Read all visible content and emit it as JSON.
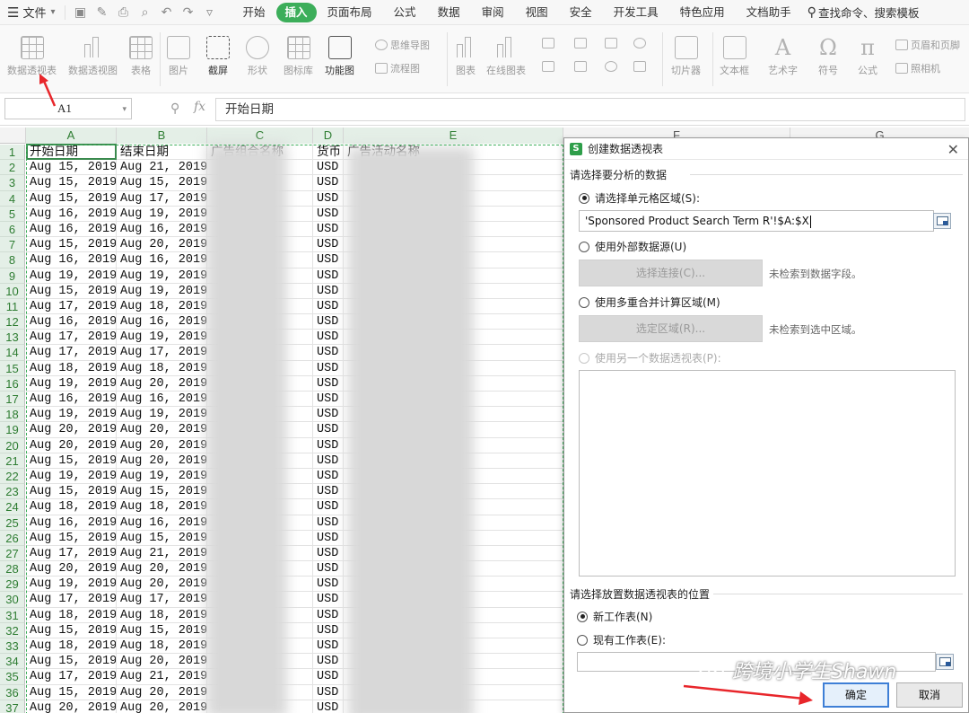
{
  "menubar": {
    "file_label": "文件",
    "tabs": [
      {
        "label": "开始",
        "active": false
      },
      {
        "label": "插入",
        "active": true
      },
      {
        "label": "页面布局",
        "active": false
      },
      {
        "label": "公式",
        "active": false
      },
      {
        "label": "数据",
        "active": false
      },
      {
        "label": "审阅",
        "active": false
      },
      {
        "label": "视图",
        "active": false
      },
      {
        "label": "安全",
        "active": false
      },
      {
        "label": "开发工具",
        "active": false
      },
      {
        "label": "特色应用",
        "active": false
      },
      {
        "label": "文档助手",
        "active": false
      }
    ],
    "search_label": "查找命令、搜索模板"
  },
  "ribbon": {
    "pivot_table": "数据透视表",
    "pivot_chart": "数据透视图",
    "table": "表格",
    "picture": "图片",
    "screenshot": "截屏",
    "shapes": "形状",
    "icon_lib": "图标库",
    "function_chart": "功能图",
    "mind_map": "思维导图",
    "flowchart": "流程图",
    "chart": "图表",
    "online_chart": "在线图表",
    "slicer": "切片器",
    "textbox": "文本框",
    "wordart": "艺术字",
    "symbol": "符号",
    "formula": "公式",
    "header_footer": "页眉和页脚",
    "camera": "照相机"
  },
  "formula_bar": {
    "name_box": "A1",
    "fx": "fx",
    "content": "开始日期"
  },
  "sheet": {
    "columns": [
      "A",
      "B",
      "C",
      "D",
      "E",
      "F",
      "G"
    ],
    "headers": {
      "A": "开始日期",
      "B": "结束日期",
      "C": "广告组合名称",
      "D": "货币",
      "E": "广告活动名称"
    },
    "row_numbers": [
      "1",
      "2",
      "3",
      "4",
      "5",
      "6",
      "7",
      "8",
      "9",
      "10",
      "11",
      "12",
      "13",
      "14",
      "15",
      "16",
      "17",
      "18",
      "19",
      "20",
      "21",
      "22",
      "23",
      "24",
      "25",
      "26",
      "27",
      "28",
      "29",
      "30",
      "31",
      "32",
      "33",
      "34",
      "35",
      "36",
      "37"
    ],
    "rows": [
      [
        "Aug 15, 2019",
        "Aug 21, 2019",
        "USD"
      ],
      [
        "Aug 15, 2019",
        "Aug 15, 2019",
        "USD"
      ],
      [
        "Aug 15, 2019",
        "Aug 17, 2019",
        "USD"
      ],
      [
        "Aug 16, 2019",
        "Aug 19, 2019",
        "USD"
      ],
      [
        "Aug 16, 2019",
        "Aug 16, 2019",
        "USD"
      ],
      [
        "Aug 15, 2019",
        "Aug 20, 2019",
        "USD"
      ],
      [
        "Aug 16, 2019",
        "Aug 16, 2019",
        "USD"
      ],
      [
        "Aug 19, 2019",
        "Aug 19, 2019",
        "USD"
      ],
      [
        "Aug 15, 2019",
        "Aug 19, 2019",
        "USD"
      ],
      [
        "Aug 17, 2019",
        "Aug 18, 2019",
        "USD"
      ],
      [
        "Aug 16, 2019",
        "Aug 16, 2019",
        "USD"
      ],
      [
        "Aug 17, 2019",
        "Aug 19, 2019",
        "USD"
      ],
      [
        "Aug 17, 2019",
        "Aug 17, 2019",
        "USD"
      ],
      [
        "Aug 18, 2019",
        "Aug 18, 2019",
        "USD"
      ],
      [
        "Aug 19, 2019",
        "Aug 20, 2019",
        "USD"
      ],
      [
        "Aug 16, 2019",
        "Aug 16, 2019",
        "USD"
      ],
      [
        "Aug 19, 2019",
        "Aug 19, 2019",
        "USD"
      ],
      [
        "Aug 20, 2019",
        "Aug 20, 2019",
        "USD"
      ],
      [
        "Aug 20, 2019",
        "Aug 20, 2019",
        "USD"
      ],
      [
        "Aug 15, 2019",
        "Aug 20, 2019",
        "USD"
      ],
      [
        "Aug 19, 2019",
        "Aug 19, 2019",
        "USD"
      ],
      [
        "Aug 15, 2019",
        "Aug 15, 2019",
        "USD"
      ],
      [
        "Aug 18, 2019",
        "Aug 18, 2019",
        "USD"
      ],
      [
        "Aug 16, 2019",
        "Aug 16, 2019",
        "USD"
      ],
      [
        "Aug 15, 2019",
        "Aug 15, 2019",
        "USD"
      ],
      [
        "Aug 17, 2019",
        "Aug 21, 2019",
        "USD"
      ],
      [
        "Aug 20, 2019",
        "Aug 20, 2019",
        "USD"
      ],
      [
        "Aug 19, 2019",
        "Aug 20, 2019",
        "USD"
      ],
      [
        "Aug 17, 2019",
        "Aug 17, 2019",
        "USD"
      ],
      [
        "Aug 18, 2019",
        "Aug 18, 2019",
        "USD"
      ],
      [
        "Aug 15, 2019",
        "Aug 15, 2019",
        "USD"
      ],
      [
        "Aug 18, 2019",
        "Aug 18, 2019",
        "USD"
      ],
      [
        "Aug 15, 2019",
        "Aug 20, 2019",
        "USD"
      ],
      [
        "Aug 17, 2019",
        "Aug 21, 2019",
        "USD"
      ],
      [
        "Aug 15, 2019",
        "Aug 20, 2019",
        "USD"
      ],
      [
        "Aug 20, 2019",
        "Aug 20, 2019",
        "USD"
      ]
    ]
  },
  "dialog": {
    "title": "创建数据透视表",
    "section1": "请选择要分析的数据",
    "opt_select_range": "请选择单元格区域(S):",
    "range_value": "'Sponsored Product Search Term R'!$A:$X",
    "opt_external": "使用外部数据源(U)",
    "btn_choose_conn": "选择连接(C)...",
    "hint_no_fields": "未检索到数据字段。",
    "opt_multi_consolidate": "使用多重合并计算区域(M)",
    "btn_select_range": "选定区域(R)...",
    "hint_no_range": "未检索到选中区域。",
    "opt_other_pivot": "使用另一个数据透视表(P):",
    "section2": "请选择放置数据透视表的位置",
    "opt_new_sheet": "新工作表(N)",
    "opt_existing_sheet": "现有工作表(E):",
    "ok": "确定",
    "cancel": "取消"
  },
  "watermark": "跨境小学生Shawn",
  "colors": {
    "accent": "#3cae5a",
    "selection": "#e4efe7",
    "arrow": "#e8262b"
  }
}
